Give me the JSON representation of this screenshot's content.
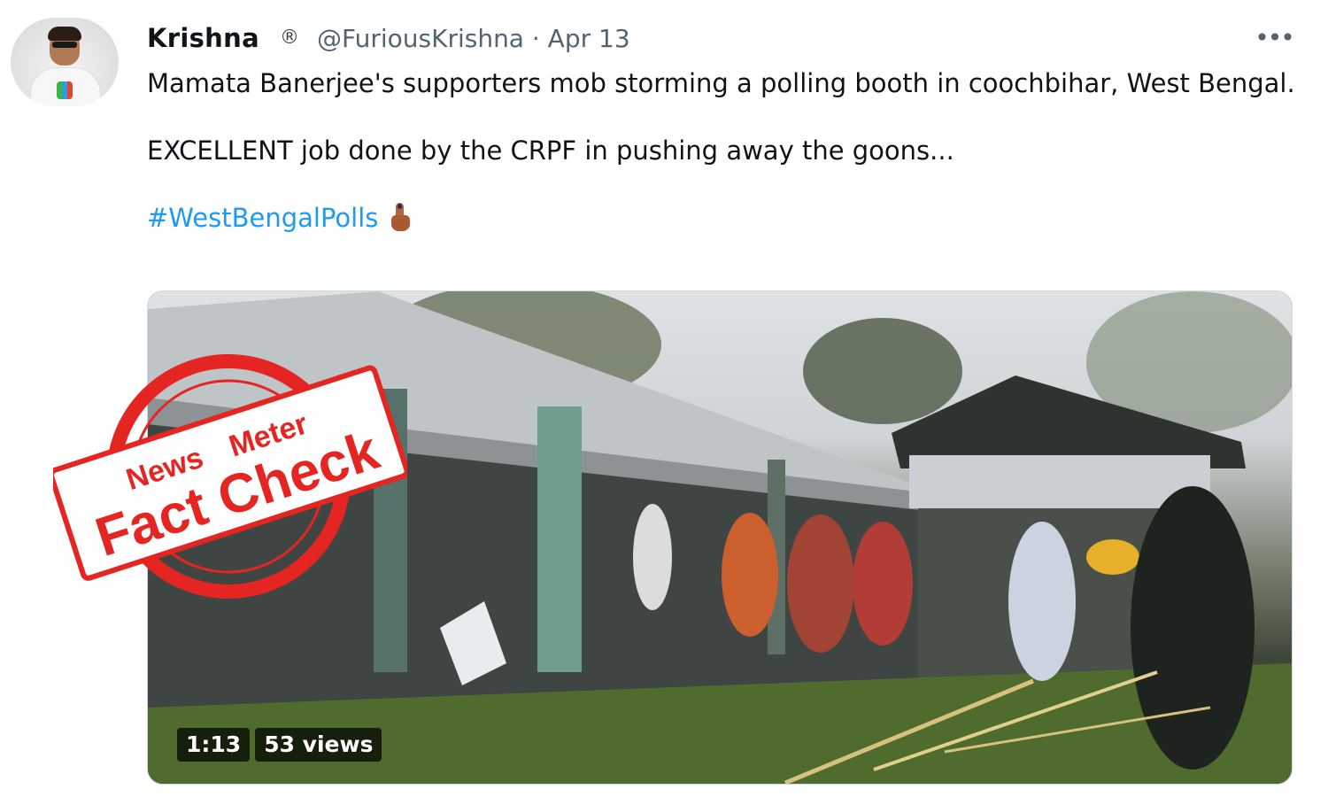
{
  "tweet": {
    "author_name": "Krishna",
    "registered_mark": "®",
    "handle_and_date": "@FuriousKrishna · Apr 13",
    "text_line1": "Mamata Banerjee's supporters mob storming a polling booth in coochbihar, West Bengal.",
    "text_line2": "EXCELLENT job done by the CRPF in pushing away the goons...",
    "hashtag": "#WestBengalPolls",
    "more_icon": "more-horizontal-icon",
    "emoji": "inked-index-finger"
  },
  "video": {
    "duration": "1:13",
    "views": "53 views"
  },
  "stamp": {
    "brand_news": "News",
    "brand_meter": "Meter",
    "label": "Fact Check",
    "color": "#e52521"
  },
  "colors": {
    "link": "#1d9bf0",
    "muted": "#536471",
    "text": "#0f1419"
  }
}
